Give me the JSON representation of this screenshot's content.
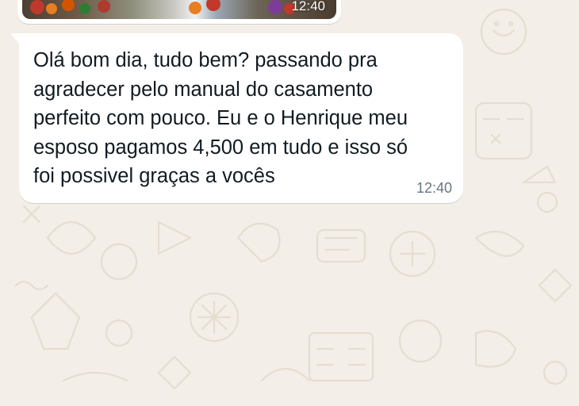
{
  "chat": {
    "wallpaper_color": "#f3eee7",
    "image_message": {
      "time": "12:40"
    },
    "text_message": {
      "text": "Olá bom dia, tudo bem? passando pra\nagradecer pelo manual do casamento\nperfeito com pouco. Eu e o Henrique meu\nesposo pagamos 4,500 em tudo e isso só\nfoi possivel graças a vocês",
      "time": "12:40",
      "bubble_color": "#ffffff"
    }
  }
}
